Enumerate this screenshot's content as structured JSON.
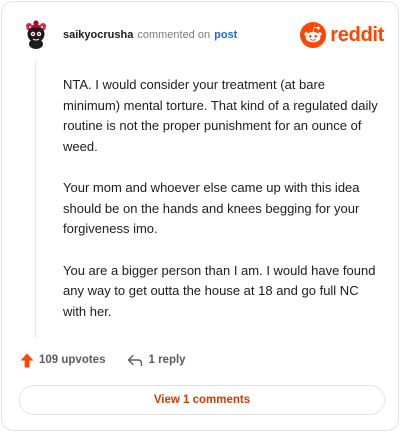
{
  "header": {
    "username": "saikyocrusha",
    "action_text": "commented on",
    "post_link": "post",
    "brand_text": "reddit",
    "brand_icon": "reddit-snoo-icon"
  },
  "comment": {
    "paragraphs": [
      "NTA. I would consider your treatment (at bare minimum) mental torture. That kind of a regulated daily routine is not the proper punishment for an ounce of weed.",
      "Your mom and whoever else came up with this idea should be on the hands and knees begging for your forgiveness imo.",
      "You are a bigger person than I am. I would have found any way to get outta the house at 18 and go full NC with her."
    ]
  },
  "actions": {
    "upvotes_label": "109 upvotes",
    "reply_label": "1 reply",
    "upvote_icon": "upvote-arrow-icon",
    "reply_icon": "reply-arrow-icon"
  },
  "footer": {
    "view_comments_label": "View 1 comments"
  },
  "colors": {
    "brand": "#ff4500",
    "link": "#1f6ad3",
    "view_button_text": "#cc3d00",
    "muted": "#7c7c7c"
  }
}
